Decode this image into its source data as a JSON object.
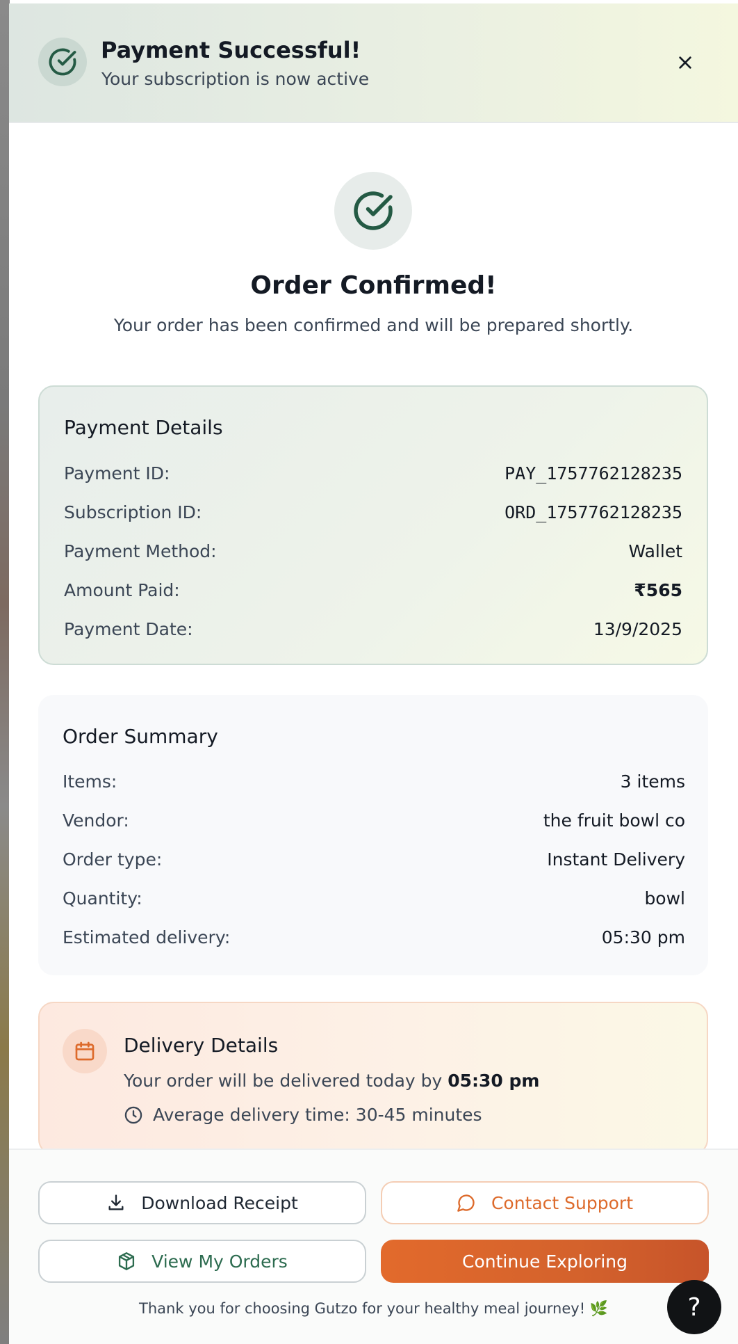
{
  "header": {
    "title": "Payment Successful!",
    "subtitle": "Your subscription is now active",
    "icon": "check-circle-icon",
    "close_icon": "close-icon"
  },
  "hero": {
    "title": "Order Confirmed!",
    "subtitle": "Your order has been confirmed and will be prepared shortly."
  },
  "payment": {
    "title": "Payment Details",
    "rows": [
      {
        "label": "Payment ID:",
        "value": "PAY_1757762128235"
      },
      {
        "label": "Subscription ID:",
        "value": "ORD_1757762128235"
      },
      {
        "label": "Payment Method:",
        "value": "Wallet"
      },
      {
        "label": "Amount Paid:",
        "value": "₹565"
      },
      {
        "label": "Payment Date:",
        "value": "13/9/2025"
      }
    ]
  },
  "summary": {
    "title": "Order Summary",
    "rows": [
      {
        "label": "Items:",
        "value": "3 items"
      },
      {
        "label": "Vendor:",
        "value": "the fruit bowl co"
      },
      {
        "label": "Order type:",
        "value": "Instant Delivery"
      },
      {
        "label": "Quantity:",
        "value": "bowl"
      },
      {
        "label": "Estimated delivery:",
        "value": "05:30 pm"
      }
    ]
  },
  "delivery": {
    "title": "Delivery Details",
    "line_prefix": "Your order will be delivered today by ",
    "line_time": "05:30 pm",
    "average": "Average delivery time: 30-45 minutes",
    "icon": "calendar-icon",
    "clock_icon": "clock-icon"
  },
  "actions": {
    "download_receipt": "Download Receipt",
    "contact_support": "Contact Support",
    "view_orders": "View My Orders",
    "continue_exploring": "Continue Exploring"
  },
  "footer": {
    "thanks": "Thank you for choosing Gutzo for your healthy meal journey! 🌿",
    "help": "?"
  },
  "colors": {
    "brand_green": "#2c6b4f",
    "accent_orange": "#dd6a2b",
    "cta_orange": "#d4622c"
  }
}
